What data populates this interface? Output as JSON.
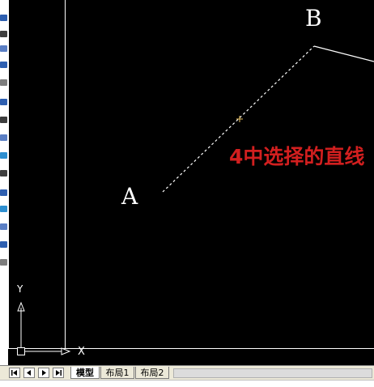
{
  "drawing": {
    "point_a_label": "A",
    "point_b_label": "B",
    "annotation_text": "4中选择的直线",
    "ucs_y_label": "Y",
    "ucs_x_label": "X"
  },
  "tabs": [
    {
      "label": "模型",
      "active": true
    },
    {
      "label": "布局1",
      "active": false
    },
    {
      "label": "布局2",
      "active": false
    }
  ],
  "colors": {
    "canvas_bg": "#000000",
    "entity": "#ffffff",
    "annotation": "#d21f1f"
  },
  "icons": {
    "nav_first": "first-layout-arrow-icon",
    "nav_prev": "previous-layout-arrow-icon",
    "nav_next": "next-layout-arrow-icon",
    "nav_last": "last-layout-arrow-icon"
  }
}
